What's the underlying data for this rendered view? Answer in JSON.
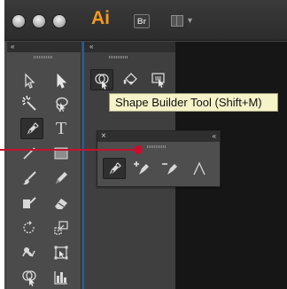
{
  "app": {
    "logo": "Ai",
    "bridge_button": "Br",
    "colors": {
      "accent_orange": "#f39a1e",
      "tooltip_bg": "#f6f3c9",
      "indicator_red": "#c8102e",
      "panel_divider_blue": "#1f5e9e"
    }
  },
  "tools_panel": {
    "collapse_glyph": "«",
    "tools": [
      {
        "name": "selection-tool",
        "icon": "selection-arrow-icon"
      },
      {
        "name": "direct-selection-tool",
        "icon": "direct-selection-arrow-icon"
      },
      {
        "name": "magic-wand-tool",
        "icon": "magic-wand-icon"
      },
      {
        "name": "lasso-tool",
        "icon": "lasso-icon"
      },
      {
        "name": "pen-tool",
        "icon": "pen-icon",
        "selected": true
      },
      {
        "name": "type-tool",
        "icon": "type-icon",
        "glyph": "T"
      },
      {
        "name": "line-segment-tool",
        "icon": "line-icon"
      },
      {
        "name": "rectangle-tool",
        "icon": "rectangle-icon"
      },
      {
        "name": "paintbrush-tool",
        "icon": "paintbrush-icon"
      },
      {
        "name": "pencil-tool",
        "icon": "pencil-icon"
      },
      {
        "name": "blob-brush-tool",
        "icon": "blob-brush-icon"
      },
      {
        "name": "eraser-tool",
        "icon": "eraser-icon"
      },
      {
        "name": "rotate-tool",
        "icon": "rotate-icon"
      },
      {
        "name": "scale-tool",
        "icon": "scale-icon"
      },
      {
        "name": "warp-tool",
        "icon": "warp-icon"
      },
      {
        "name": "free-transform-tool",
        "icon": "free-transform-icon"
      },
      {
        "name": "shape-builder-tool",
        "icon": "shape-builder-icon"
      },
      {
        "name": "graph-tool",
        "icon": "graph-icon"
      }
    ]
  },
  "second_column": {
    "collapse_glyph": "«",
    "tools": [
      {
        "name": "shape-builder-tool",
        "icon": "shape-builder-icon",
        "selected": true
      },
      {
        "name": "live-paint-bucket-tool",
        "icon": "live-paint-bucket-icon"
      },
      {
        "name": "live-paint-selection-tool",
        "icon": "live-paint-selection-icon"
      }
    ]
  },
  "tooltip": {
    "text": "Shape Builder Tool (Shift+M)"
  },
  "pen_flyout": {
    "close_glyph": "×",
    "collapse_glyph": "«",
    "tools": [
      {
        "name": "pen-tool",
        "icon": "pen-icon",
        "selected": true
      },
      {
        "name": "add-anchor-point-tool",
        "icon": "add-anchor-point-icon"
      },
      {
        "name": "delete-anchor-point-tool",
        "icon": "delete-anchor-point-icon"
      },
      {
        "name": "convert-anchor-point-tool",
        "icon": "convert-anchor-point-icon"
      }
    ]
  }
}
